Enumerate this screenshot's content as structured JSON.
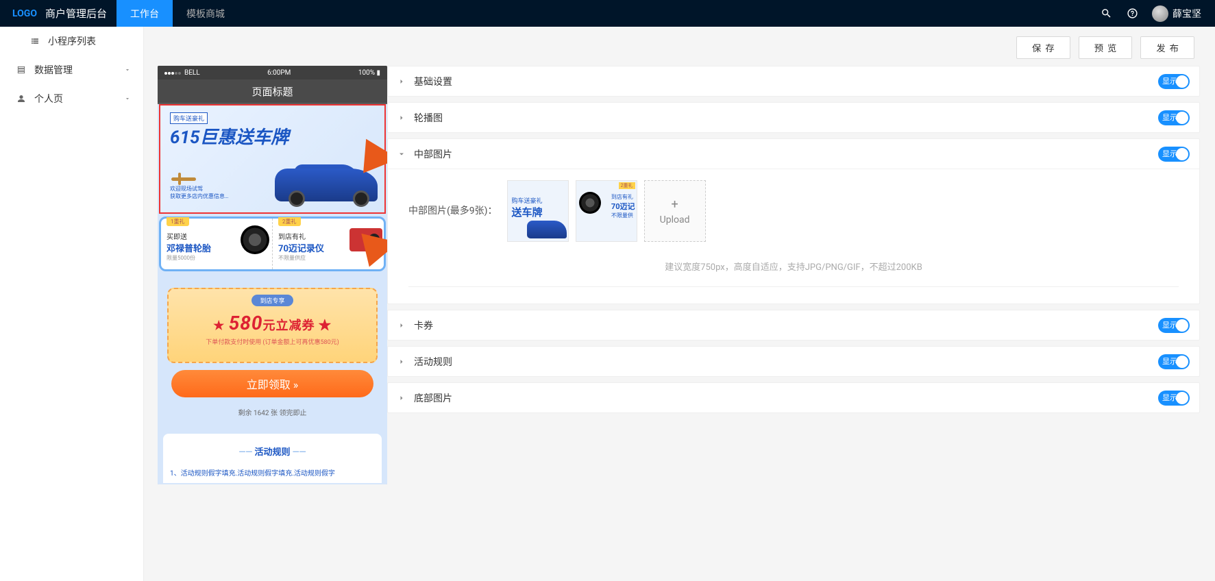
{
  "header": {
    "logo": "LOGO",
    "brand": "商户管理后台",
    "nav_workbench": "工作台",
    "nav_templates": "模板商城",
    "username": "薛宝坚"
  },
  "sidebar": {
    "miniprogram_list": "小程序列表",
    "data_mgmt": "数据管理",
    "profile": "个人页"
  },
  "actions": {
    "save": "保存",
    "preview": "预览",
    "publish": "发布"
  },
  "phone": {
    "carrier": "BELL",
    "time": "6:00PM",
    "battery": "100%",
    "page_title": "页面标题",
    "banner_tag": "购车送豪礼",
    "banner_title_a": "615巨惠",
    "banner_title_b": "送车牌",
    "banner_sub": "欢迎现场试驾\n获取更多店内优惠信息…",
    "gift1_tag": "1重礼",
    "gift1_l1": "买即送",
    "gift1_l2": "邓禄普轮胎",
    "gift1_l3": "限量5000份",
    "gift2_tag": "2重礼",
    "gift2_l1": "到店有礼",
    "gift2_l2": "70迈记录仪",
    "gift2_l3": "不限量供应",
    "coupon_tag": "到店专享",
    "coupon_amount": "580",
    "coupon_unit": "元立减券",
    "coupon_sub": "下单付款支付时使用 (订单金额上可再优惠580元)",
    "get_btn": "立即领取 »",
    "remain": "剩余 1642 张 领完即止",
    "rules_title": "活动规则",
    "rules_line": "1、活动规则假字填充.活动规则假字填充.活动规则假字"
  },
  "settings": {
    "base": "基础设置",
    "carousel": "轮播图",
    "middle_img": "中部图片",
    "middle_img_label": "中部图片(最多9张)：",
    "upload": "Upload",
    "tip": "建议宽度750px，高度自适应，支持JPG/PNG/GIF，不超过200KB",
    "card": "卡券",
    "rules": "活动规则",
    "bottom_img": "底部图片",
    "toggle_on": "显示"
  },
  "thumbs": {
    "t1_small": "购车送豪礼",
    "t1_big": "送车牌",
    "t2_tag": "2重礼",
    "t2_l1": "到店有礼",
    "t2_l2": "70迈记",
    "t2_l3": "不限量供"
  }
}
